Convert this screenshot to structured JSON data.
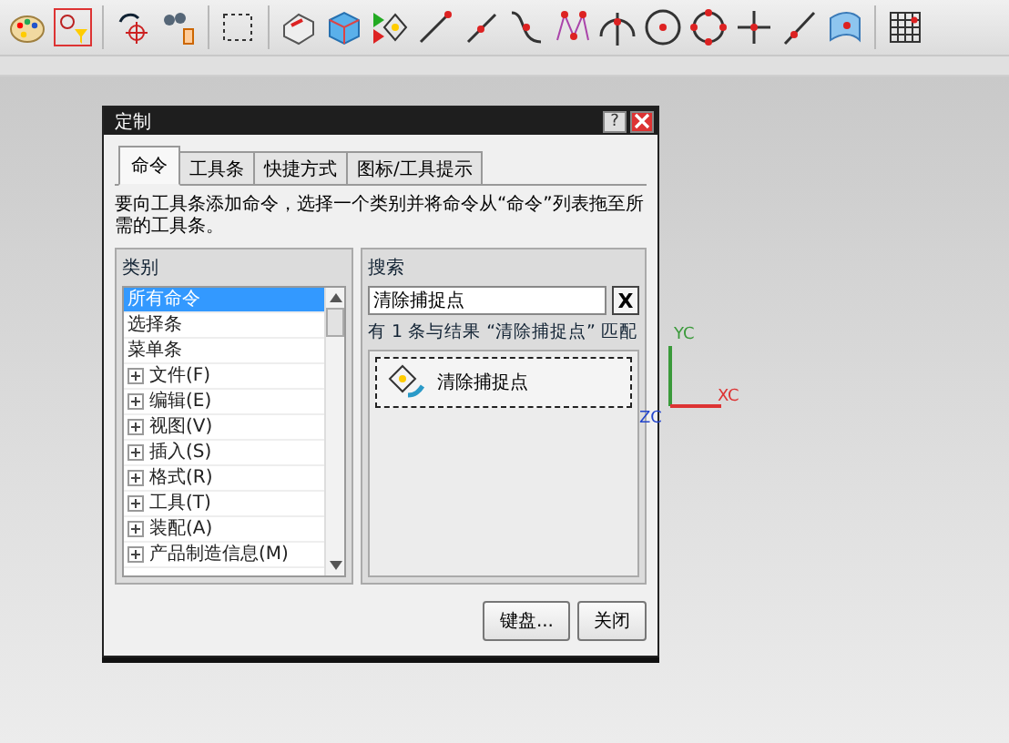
{
  "dialog": {
    "title": "定制",
    "help_glyph": "?",
    "tabs": [
      {
        "label": "命令",
        "selected": true
      },
      {
        "label": "工具条",
        "selected": false
      },
      {
        "label": "快捷方式",
        "selected": false
      },
      {
        "label": "图标/工具提示",
        "selected": false
      }
    ],
    "instruction": "要向工具条添加命令，选择一个类别并将命令从“命令”列表拖至所需的工具条。",
    "categories": {
      "heading": "类别",
      "items": [
        {
          "label": "所有命令",
          "kind": "plain",
          "selected": true
        },
        {
          "label": "选择条",
          "kind": "plain",
          "selected": false
        },
        {
          "label": "菜单条",
          "kind": "plain",
          "selected": false
        },
        {
          "label": "文件(F)",
          "kind": "group",
          "expanded": false,
          "selected": false
        },
        {
          "label": "编辑(E)",
          "kind": "group",
          "expanded": false,
          "selected": false
        },
        {
          "label": "视图(V)",
          "kind": "group",
          "expanded": false,
          "selected": false
        },
        {
          "label": "插入(S)",
          "kind": "group",
          "expanded": false,
          "selected": false
        },
        {
          "label": "格式(R)",
          "kind": "group",
          "expanded": false,
          "selected": false
        },
        {
          "label": "工具(T)",
          "kind": "group",
          "expanded": false,
          "selected": false
        },
        {
          "label": "装配(A)",
          "kind": "group",
          "expanded": false,
          "selected": false
        },
        {
          "label": "产品制造信息(M)",
          "kind": "group",
          "expanded": false,
          "selected": false
        }
      ]
    },
    "search": {
      "heading": "搜索",
      "value": "清除捕捉点",
      "clear_glyph": "X"
    },
    "results": {
      "summary": "有 1 条与结果 “清除捕捉点” 匹配",
      "items": [
        {
          "label": "清除捕捉点",
          "selected": true
        }
      ]
    },
    "buttons": [
      "键盘...",
      "关闭"
    ]
  },
  "axes": {
    "y": "YC",
    "x": "XC",
    "z": "ZC"
  }
}
